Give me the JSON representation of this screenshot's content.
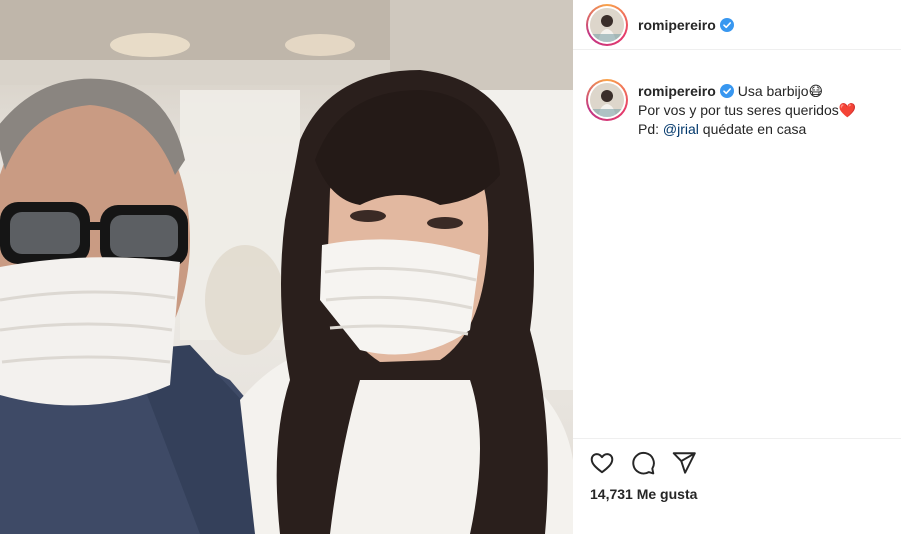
{
  "post": {
    "username": "romipereiro",
    "caption_line1": "Usa barbijo",
    "caption_emoji1": "😷",
    "caption_line2": "Por vos y por tus seres queridos",
    "caption_emoji2": "❤️",
    "caption_pd": "Pd:",
    "caption_mention": "@jrial",
    "caption_end": "quédate en casa",
    "likes_text": "14,731 Me gusta"
  },
  "colors": {
    "verified": "#3897f0",
    "mention": "#00376b",
    "text": "#262626"
  },
  "icons": [
    "heart-icon",
    "comment-icon",
    "share-icon",
    "verified-icon"
  ]
}
